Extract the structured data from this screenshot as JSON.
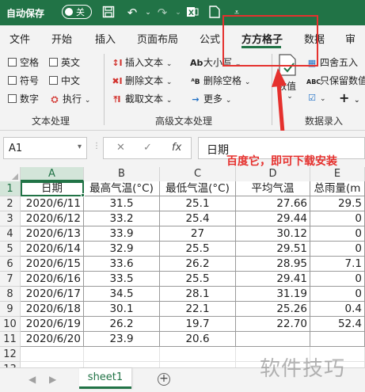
{
  "titlebar": {
    "autosave_label": "自动保存",
    "toggle_state": "关"
  },
  "tabs": [
    "文件",
    "开始",
    "插入",
    "页面布局",
    "公式",
    "方方格子",
    "数据",
    "审阅"
  ],
  "active_tab": "方方格子",
  "ribbon": {
    "text_group": {
      "checkboxes": [
        "空格",
        "英文",
        "符号",
        "中文",
        "数字"
      ],
      "execute": "执行",
      "label": "文本处理"
    },
    "advanced_group": {
      "buttons": [
        "插入文本",
        "删除文本",
        "截取文本",
        "大小写",
        "删除空格",
        "更多"
      ],
      "label": "高级文本处理"
    },
    "number_group": {
      "value_button": "数值",
      "round_button": "四舍五入",
      "keep_value_button": "只保留数值",
      "label": "数据录入"
    }
  },
  "formula_bar": {
    "name_box": "A1",
    "content": "日期",
    "fx_label": "fx"
  },
  "annotation_caption": "百度它，即可下载安装",
  "sheet": {
    "columns": [
      "A",
      "B",
      "C",
      "D",
      "E"
    ],
    "rows": [
      "1",
      "2",
      "3",
      "4",
      "5",
      "6",
      "7",
      "8",
      "9",
      "10",
      "11",
      "12",
      "13"
    ],
    "headers": [
      "日期",
      "最高气温(°C)",
      "最低气温(°C)",
      "平均气温",
      "总雨量(m"
    ],
    "data": [
      [
        "2020/6/11",
        "31.5",
        "25.1",
        "27.66",
        "29.5"
      ],
      [
        "2020/6/12",
        "33.2",
        "25.4",
        "29.44",
        "0"
      ],
      [
        "2020/6/13",
        "33.9",
        "27",
        "30.12",
        "0"
      ],
      [
        "2020/6/14",
        "32.9",
        "25.5",
        "29.51",
        "0"
      ],
      [
        "2020/6/15",
        "33.6",
        "26.2",
        "28.95",
        "7.1"
      ],
      [
        "2020/6/16",
        "33.5",
        "25.5",
        "29.41",
        "0"
      ],
      [
        "2020/6/17",
        "34.5",
        "28.1",
        "31.19",
        "0"
      ],
      [
        "2020/6/18",
        "30.1",
        "22.1",
        "25.26",
        "0.4"
      ],
      [
        "2020/6/19",
        "26.2",
        "19.7",
        "22.70",
        "52.4"
      ],
      [
        "2020/6/20",
        "23.9",
        "20.6",
        "",
        ""
      ]
    ]
  },
  "sheet_tab": "sheet1",
  "watermark": "软件技巧",
  "colors": {
    "excel_green": "#217346",
    "highlight_red": "#e5312e"
  }
}
